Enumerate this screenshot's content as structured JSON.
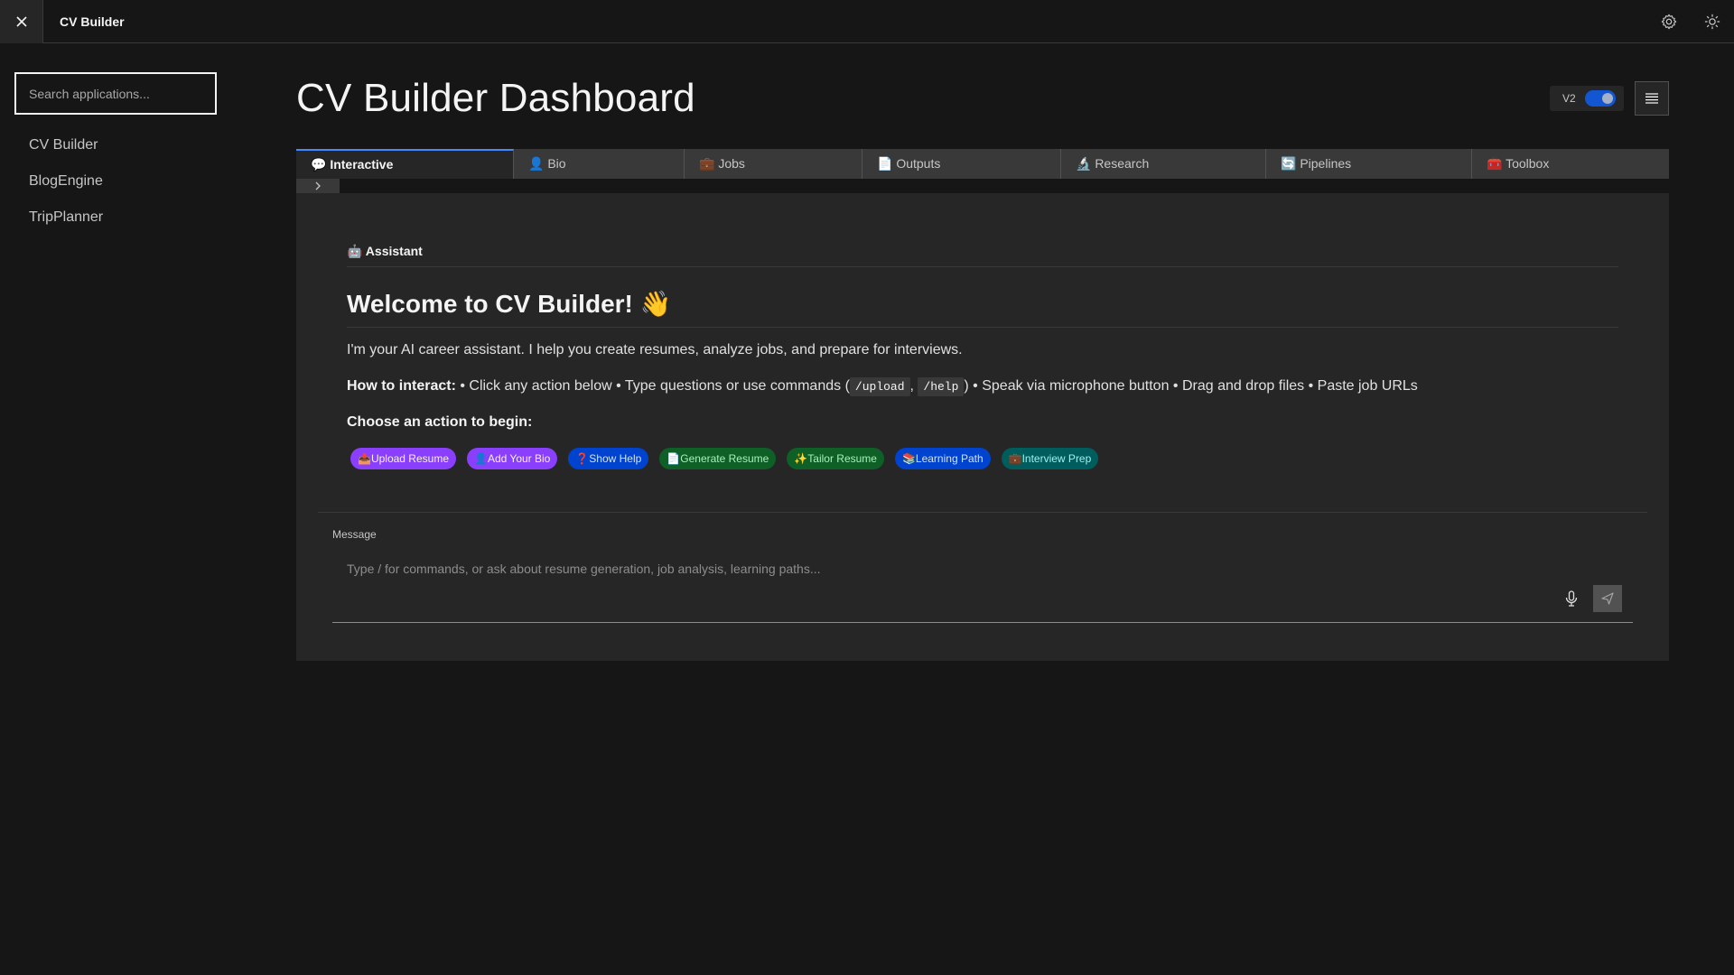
{
  "header": {
    "app_name": "CV Builder"
  },
  "sidebar": {
    "search_placeholder": "Search applications...",
    "items": [
      {
        "label": "CV Builder"
      },
      {
        "label": "BlogEngine"
      },
      {
        "label": "TripPlanner"
      }
    ]
  },
  "main": {
    "title": "CV Builder Dashboard",
    "toggle_label": "V2",
    "tabs": [
      {
        "label": "💬 Interactive"
      },
      {
        "label": "👤 Bio"
      },
      {
        "label": "💼 Jobs"
      },
      {
        "label": "📄 Outputs"
      },
      {
        "label": "🔬 Research"
      },
      {
        "label": "🔄 Pipelines"
      },
      {
        "label": "🧰 Toolbox"
      }
    ]
  },
  "chat": {
    "assistant_label": "🤖 Assistant",
    "welcome_title": "Welcome to CV Builder! 👋",
    "intro": "I'm your AI career assistant. I help you create resumes, analyze jobs, and prepare for interviews.",
    "how_label": "How to interact:",
    "how_part1": " • Click any action below • Type questions or use commands (",
    "cmd_upload": "/upload",
    "how_sep": ", ",
    "cmd_help": "/help",
    "how_part2": ") • Speak via microphone button • Drag and drop files • Paste job URLs",
    "choose_label": "Choose an action to begin:",
    "actions": [
      {
        "label": "📤Upload Resume",
        "bg": "#8a3ffc",
        "fg": "#f6f2ff"
      },
      {
        "label": "👤Add Your Bio",
        "bg": "#8a3ffc",
        "fg": "#f6f2ff"
      },
      {
        "label": "❓Show Help",
        "bg": "#0043ce",
        "fg": "#d0e2ff"
      },
      {
        "label": "📄Generate Resume",
        "bg": "#0e6027",
        "fg": "#a7f0ba"
      },
      {
        "label": "✨Tailor Resume",
        "bg": "#0e6027",
        "fg": "#a7f0ba"
      },
      {
        "label": "📚Learning Path",
        "bg": "#0043ce",
        "fg": "#d0e2ff"
      },
      {
        "label": "💼Interview Prep",
        "bg": "#005d5d",
        "fg": "#9ef0f0"
      }
    ],
    "message_label": "Message",
    "message_placeholder": "Type / for commands, or ask about resume generation, job analysis, learning paths..."
  },
  "colors": {
    "accent": "#0f62fe",
    "background": "#161616",
    "panel": "#262626"
  }
}
